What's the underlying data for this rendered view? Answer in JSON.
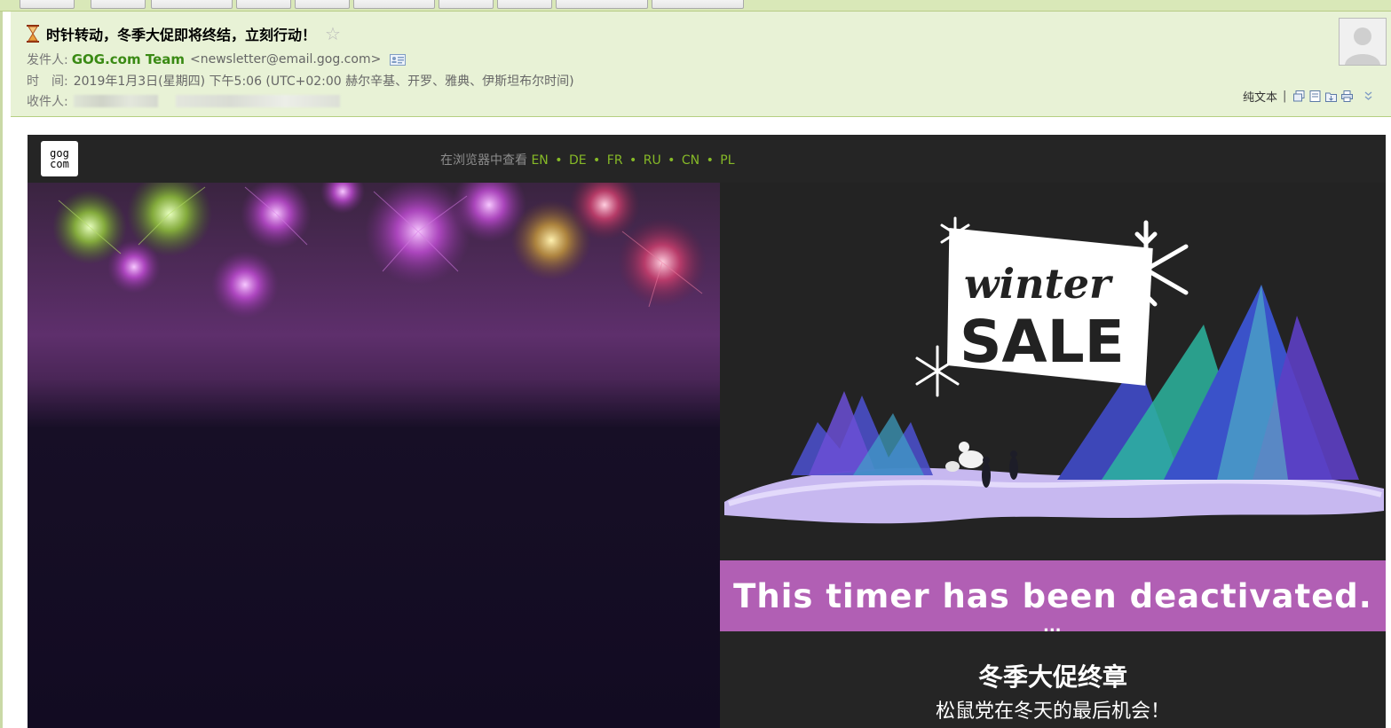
{
  "mail": {
    "subject": "时针转动，冬季大促即将终结，立刻行动！",
    "from_label": "发件人:",
    "from_name": "GOG.com Team",
    "from_email": "<newsletter@email.gog.com>",
    "time_label": "时　间:",
    "time_value": "2019年1月3日(星期四) 下午5:06 (UTC+02:00 赫尔辛基、开罗、雅典、伊斯坦布尔时间)",
    "to_label": "收件人:",
    "plaintext_label": "纯文本",
    "separator": "|"
  },
  "email": {
    "logo_text_top": "gog",
    "logo_text_bottom": "com",
    "view_in_browser": "在浏览器中查看",
    "languages": [
      "EN",
      "DE",
      "FR",
      "RU",
      "CN",
      "PL"
    ],
    "banner_word_top": "winter",
    "banner_word_bottom": "SALE",
    "timer_text": "This timer has been deactivated.",
    "timer_dots": "...",
    "promo_title": "冬季大促终章",
    "promo_subtitle": "松鼠党在冬天的最后机会！"
  },
  "colors": {
    "header_bg": "#e8f2d6",
    "sender_green": "#3a8a14",
    "lang_green": "#86b927",
    "email_bg": "#252525",
    "timer_band": "#b15fb4"
  }
}
